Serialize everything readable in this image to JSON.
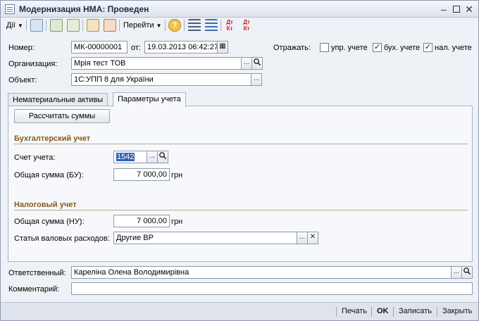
{
  "window": {
    "title": "Модернизация НМА: Проведен"
  },
  "toolbar": {
    "actions_label": "Дії",
    "goto_label": "Перейти",
    "help_glyph": "?"
  },
  "header": {
    "number_label": "Номер:",
    "number_value": "МК-00000001",
    "date_label": "от:",
    "date_value": "19.03.2013 06:42:27",
    "reflect_label": "Отражать:",
    "reflect_mgmt_label": "упр. учете",
    "reflect_acc_label": "бух. учете",
    "reflect_tax_label": "нал. учете",
    "org_label": "Организация:",
    "org_value": "Мрія тест ТОВ",
    "object_label": "Объект:",
    "object_value": "1С:УПП 8 для України"
  },
  "tabs": [
    {
      "label": "Нематериальные активы",
      "active": false
    },
    {
      "label": "Параметры учета",
      "active": true
    }
  ],
  "panel": {
    "calc_button": "Рассчитать суммы",
    "acc_section": "Бухгалтерский учет",
    "acc_account_label": "Счет учета:",
    "acc_account_value": "1542",
    "acc_total_label": "Общая сумма (БУ):",
    "acc_total_value": "7 000,00",
    "currency": "грн",
    "tax_section": "Налоговый учет",
    "tax_total_label": "Общая сумма (НУ):",
    "tax_total_value": "7 000,00",
    "expense_label": "Статья валовых расходов:",
    "expense_value": "Другие ВР"
  },
  "bottom": {
    "responsible_label": "Ответственный:",
    "responsible_value": "Кареліна Олена Володимирівна",
    "comment_label": "Комментарий:",
    "comment_value": ""
  },
  "footer": {
    "print": "Печать",
    "ok": "OK",
    "save": "Записать",
    "close": "Закрыть"
  },
  "icons": {
    "ellipsis": "...",
    "search": "🔍",
    "clear": "✕",
    "calendar": "▦",
    "check": "✓"
  }
}
